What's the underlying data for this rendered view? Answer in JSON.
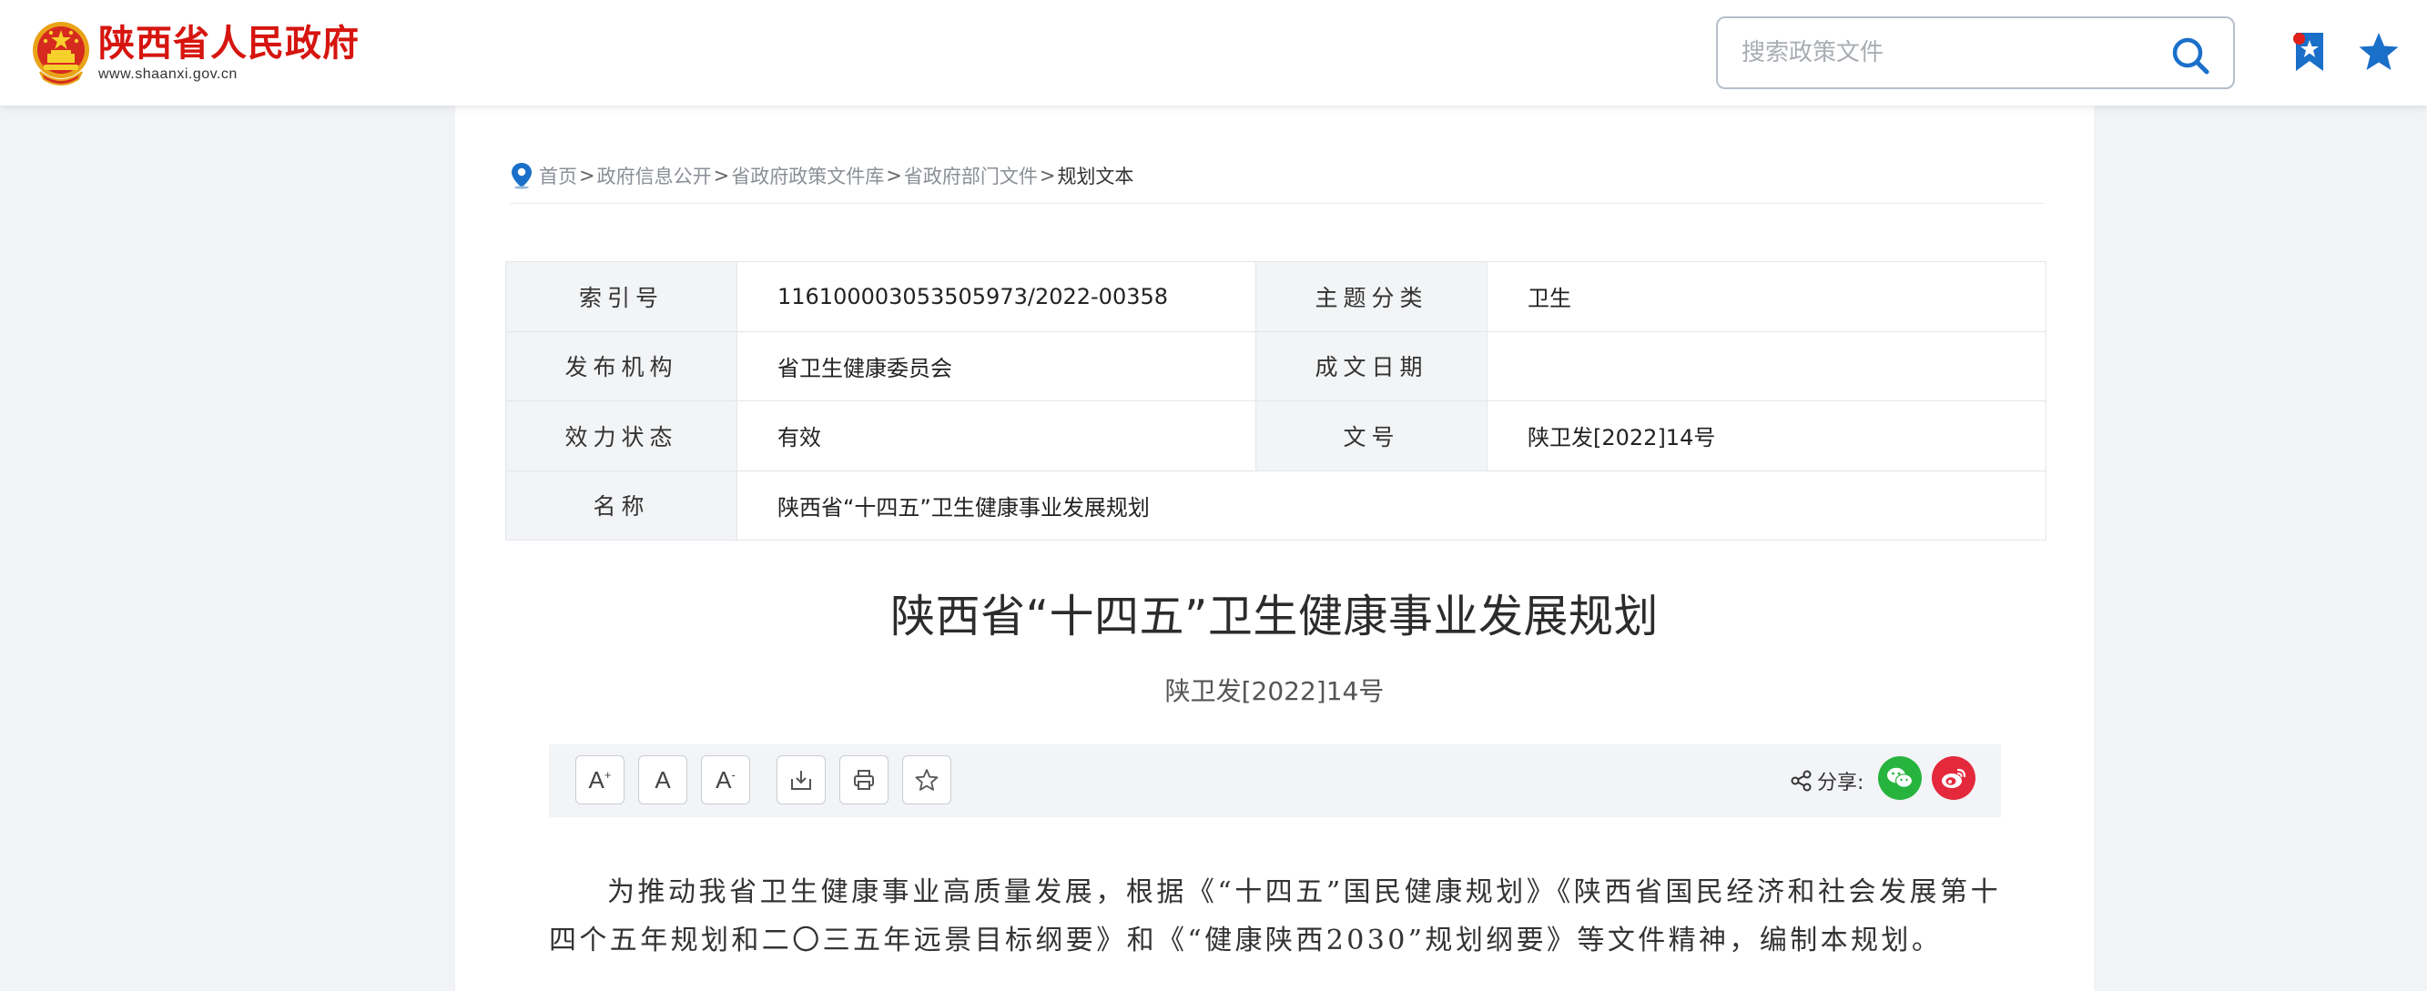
{
  "header": {
    "site_title": "陕西省人民政府",
    "site_url": "www.shaanxi.gov.cn",
    "search_placeholder": "搜索政策文件",
    "accent_color": "#d6150f",
    "icon_color": "#1a6fc9",
    "icons": [
      "national-emblem-icon",
      "search-icon",
      "bookmark-icon",
      "star-icon"
    ]
  },
  "breadcrumb": {
    "items": [
      "首页",
      "政府信息公开",
      "省政府政策文件库",
      "省政府部门文件"
    ],
    "current": "规划文本",
    "separator": ">"
  },
  "info": {
    "index_label": "索引号",
    "index_value": "116100003053505973/2022-00358",
    "topic_label": "主题分类",
    "topic_value": "卫生",
    "publisher_label": "发布机构",
    "publisher_value": "省卫生健康委员会",
    "date_label": "成文日期",
    "date_value": "",
    "status_label": "效力状态",
    "status_value": "有效",
    "docno_label": "文号",
    "docno_value": "陕卫发[2022]14号",
    "name_label": "名称",
    "name_value": "陕西省“十四五”卫生健康事业发展规划"
  },
  "document": {
    "title": "陕西省“十四五”卫生健康事业发展规划",
    "number": "陕卫发[2022]14号",
    "paragraph": "为推动我省卫生健康事业高质量发展，根据《“十四五”国民健康规划》《陕西省国民经济和社会发展第十四个五年规划和二〇三五年远景目标纲要》和《“健康陕西2030”规划纲要》等文件精神，编制本规划。"
  },
  "toolbar": {
    "font_larger": "A",
    "font_larger_sup": "+",
    "font_normal": "A",
    "font_smaller": "A",
    "font_smaller_sup": "-",
    "share_label": "分享:",
    "icons": [
      "download-icon",
      "print-icon",
      "star-outline-icon",
      "share-icon",
      "wechat-icon",
      "weibo-icon"
    ]
  }
}
